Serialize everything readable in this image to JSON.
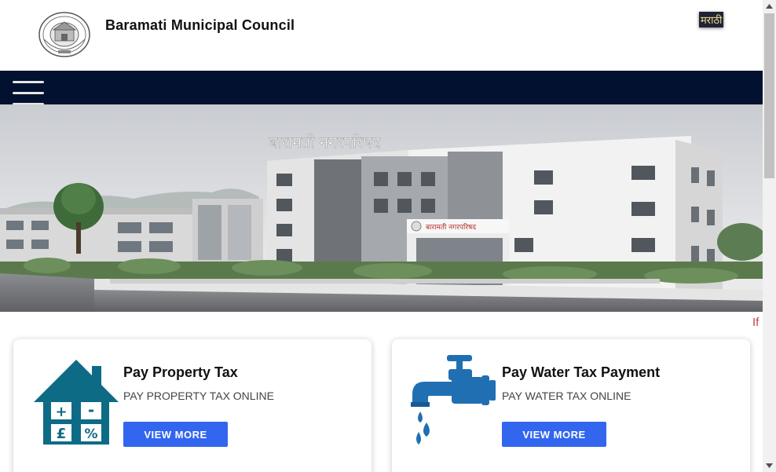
{
  "header": {
    "title": "Baramati Municipal Council",
    "language_button": "मराठी"
  },
  "hero": {
    "building_sign": "बारामती नगरपरिषद",
    "entrance_sign": "बारामती नगरपरिषद"
  },
  "marquee": {
    "text": "If"
  },
  "cards": [
    {
      "title": "Pay Property Tax",
      "subtitle": "PAY PROPERTY TAX ONLINE",
      "button": "VIEW MORE",
      "icon": "house-tax-icon",
      "icon_symbols": [
        "+",
        "-",
        "£",
        "%"
      ]
    },
    {
      "title": "Pay Water Tax Payment",
      "subtitle": "PAY WATER TAX ONLINE",
      "button": "VIEW MORE",
      "icon": "water-tap-icon"
    }
  ],
  "colors": {
    "navbar": "#02112f",
    "button": "#3366ee",
    "house_icon": "#0e6b86",
    "tap_icon": "#1f6fb2"
  }
}
